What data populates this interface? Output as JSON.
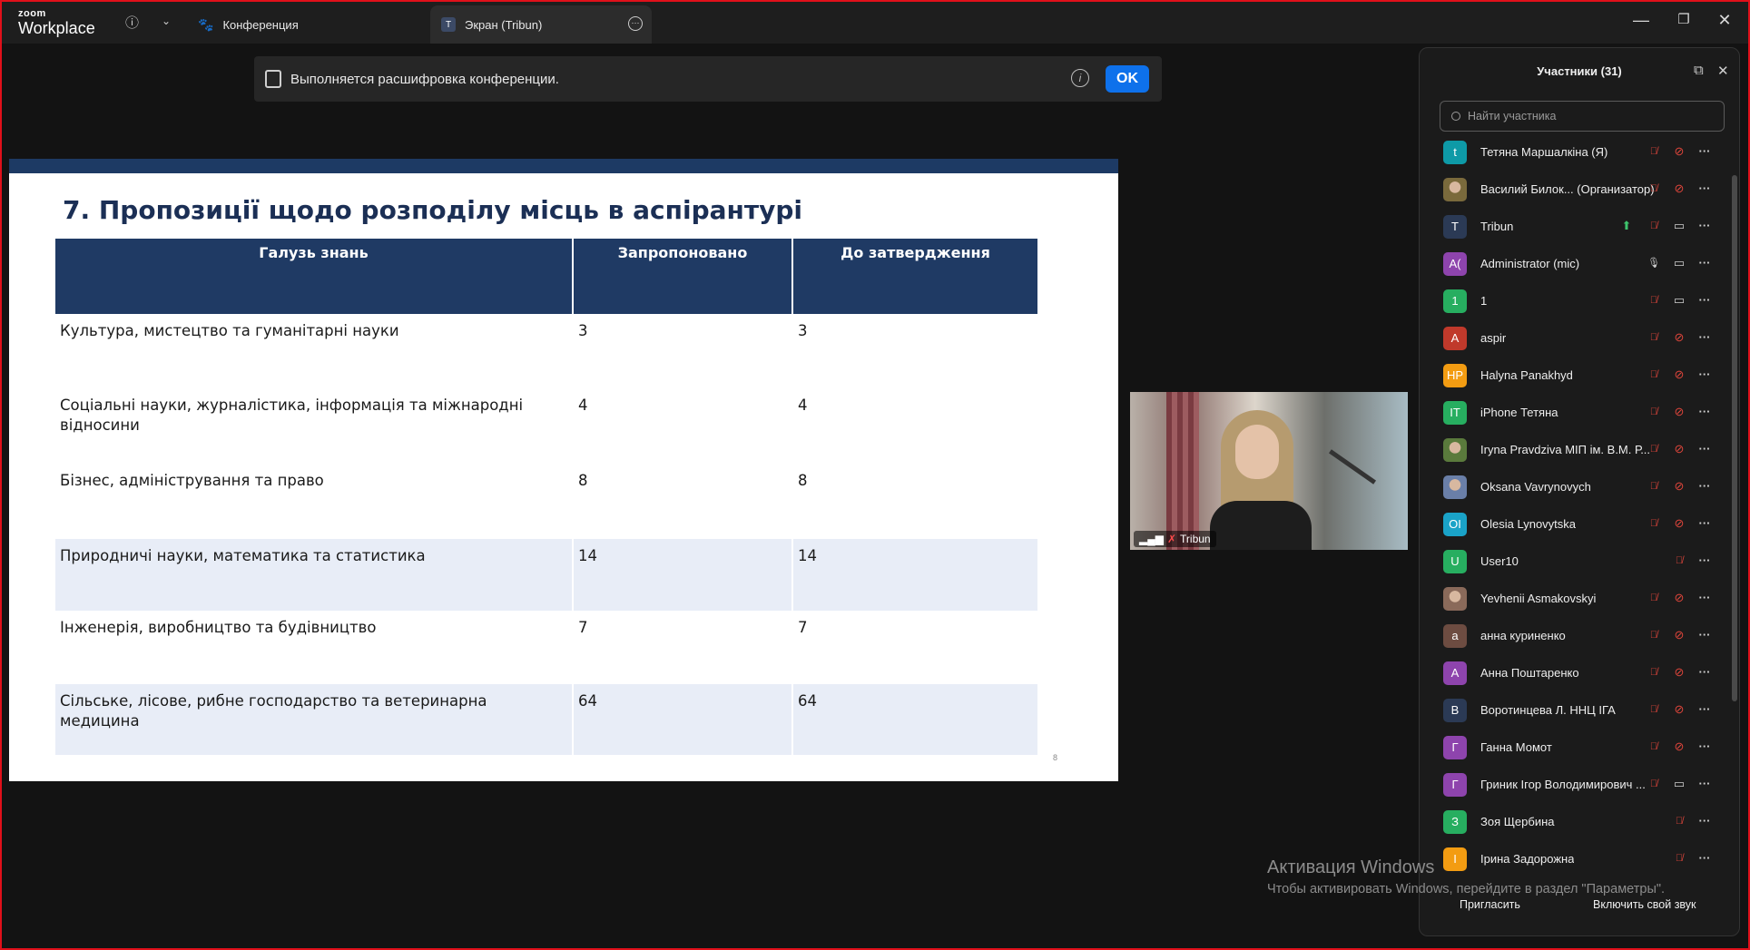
{
  "app": {
    "logo_small": "zoom",
    "logo_big": "Workplace"
  },
  "tabs": [
    {
      "label": "Конференция",
      "icon": "paw-icon"
    },
    {
      "label": "Экран (Tribun)",
      "badge": "T"
    }
  ],
  "banner": {
    "text": "Выполняется расшифровка конференции.",
    "ok_label": "OK"
  },
  "slide": {
    "title": "7. Пропозиції щодо розподілу місць в аспірантурі",
    "headers": [
      "Галузь знань",
      "Запропоновано",
      "До затвердження"
    ],
    "rows": [
      [
        "Культура, мистецтво та гуманітарні науки",
        "3",
        "3"
      ],
      [
        "Соціальні науки, журналістика, інформація та міжнародні відносини",
        "4",
        "4"
      ],
      [
        "Бізнес, адміністрування та право",
        "8",
        "8"
      ],
      [
        "Природничі науки, математика та статистика",
        "14",
        "14"
      ],
      [
        "Інженерія, виробництво та будівництво",
        "7",
        "7"
      ],
      [
        "Сільське, лісове, рибне господарство та ветеринарна медицина",
        "64",
        "64"
      ]
    ],
    "page_number": "8"
  },
  "video": {
    "name": "Tribun"
  },
  "panel": {
    "title": "Участники (31)",
    "search_placeholder": "Найти участника",
    "participants": [
      {
        "name": "Тетяна Маршалкіна (Я)",
        "initials": "t",
        "color": "#0e9aa7",
        "mic": "muted",
        "cam": "off"
      },
      {
        "name": "Василий Билок... (Организатор)",
        "initials": "",
        "color": "#7a6a3c",
        "mic": "muted",
        "cam": "off",
        "photo": true
      },
      {
        "name": "Tribun",
        "initials": "T",
        "color": "#2b3a55",
        "mic": "muted",
        "cam": "on",
        "share": true
      },
      {
        "name": "Administrator (mic)",
        "initials": "A(",
        "color": "#8e44ad",
        "mic": "on",
        "cam": "on"
      },
      {
        "name": "1",
        "initials": "1",
        "color": "#27ae60",
        "mic": "muted",
        "cam": "on"
      },
      {
        "name": "aspir",
        "initials": "A",
        "color": "#c0392b",
        "mic": "muted",
        "cam": "off"
      },
      {
        "name": "Halyna Panakhyd",
        "initials": "HP",
        "color": "#f39c12",
        "mic": "muted",
        "cam": "off"
      },
      {
        "name": "iPhone Тетяна",
        "initials": "IT",
        "color": "#27ae60",
        "mic": "muted",
        "cam": "off"
      },
      {
        "name": "Iryna Pravdziva МІП ім. В.М. Р...",
        "initials": "",
        "color": "#5a7a3c",
        "mic": "muted",
        "cam": "off",
        "photo": true
      },
      {
        "name": "Oksana Vavrynovych",
        "initials": "",
        "color": "#6a7fa8",
        "mic": "muted",
        "cam": "off",
        "photo": true
      },
      {
        "name": "Olesia Lynovytska",
        "initials": "OI",
        "color": "#1aa3c8",
        "mic": "muted",
        "cam": "off"
      },
      {
        "name": "User10",
        "initials": "U",
        "color": "#27ae60",
        "mic": "muted",
        "cam": "none"
      },
      {
        "name": "Yevhenii Asmakovskyi",
        "initials": "",
        "color": "#8a6a5a",
        "mic": "muted",
        "cam": "off",
        "photo": true
      },
      {
        "name": "анна куриненко",
        "initials": "а",
        "color": "#6d4c41",
        "mic": "muted",
        "cam": "off"
      },
      {
        "name": "Анна Поштаренко",
        "initials": "А",
        "color": "#8e44ad",
        "mic": "muted",
        "cam": "off"
      },
      {
        "name": "Воротинцева Л. ННЦ ІГА",
        "initials": "В",
        "color": "#2b3a55",
        "mic": "muted",
        "cam": "off"
      },
      {
        "name": "Ганна Момот",
        "initials": "Г",
        "color": "#8e44ad",
        "mic": "muted",
        "cam": "off"
      },
      {
        "name": "Гриник Ігор Володимирович ...",
        "initials": "Г",
        "color": "#8e44ad",
        "mic": "muted",
        "cam": "on"
      },
      {
        "name": "Зоя Щербина",
        "initials": "З",
        "color": "#27ae60",
        "mic": "muted",
        "cam": "none"
      },
      {
        "name": "Ірина Задорожна",
        "initials": "І",
        "color": "#f39c12",
        "mic": "muted",
        "cam": "none"
      }
    ],
    "invite_label": "Пригласить",
    "unmute_label": "Включить свой звук"
  },
  "watermark": {
    "line1": "Активация Windows",
    "line2": "Чтобы активировать Windows, перейдите в раздел \"Параметры\"."
  }
}
